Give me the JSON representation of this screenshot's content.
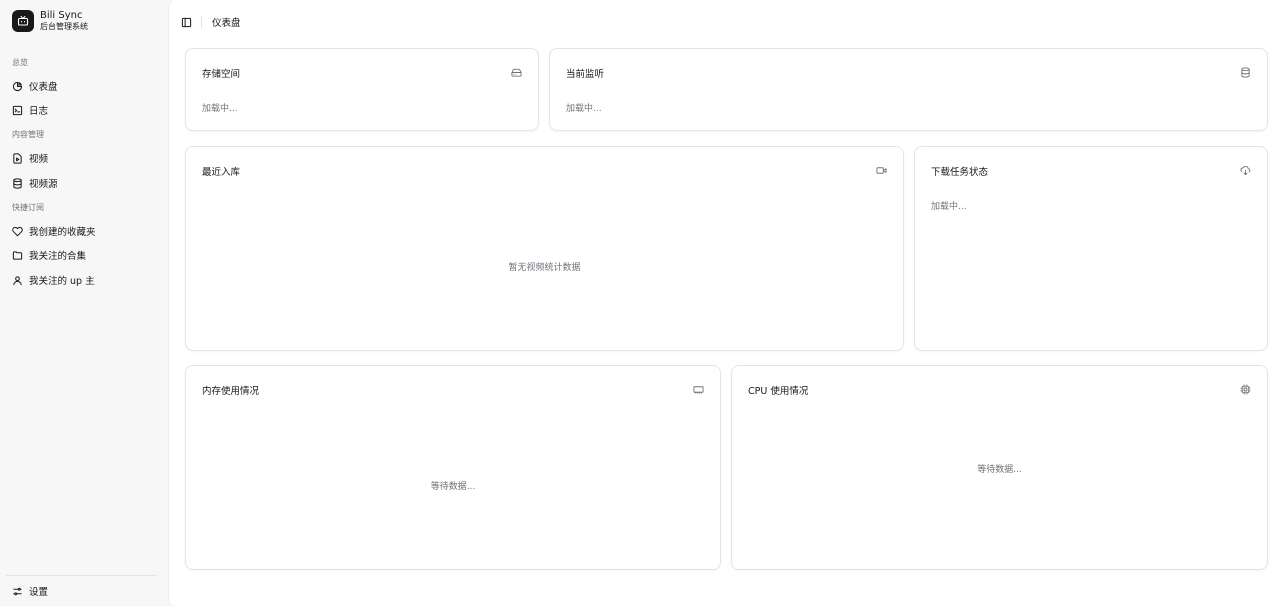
{
  "brand": {
    "name": "Bili Sync",
    "subtitle": "后台管理系统"
  },
  "sidebar": {
    "groups": [
      {
        "label": "总览"
      },
      {
        "label": "内容管理"
      },
      {
        "label": "快捷订阅"
      }
    ],
    "items": [
      {
        "label": "仪表盘",
        "icon": "pie-chart-icon"
      },
      {
        "label": "日志",
        "icon": "terminal-icon"
      },
      {
        "label": "视频",
        "icon": "file-video-icon"
      },
      {
        "label": "视频源",
        "icon": "database-icon"
      },
      {
        "label": "我创建的收藏夹",
        "icon": "heart-icon"
      },
      {
        "label": "我关注的合集",
        "icon": "folder-icon"
      },
      {
        "label": "我关注的 up 主",
        "icon": "user-icon"
      }
    ],
    "footer": {
      "label": "设置",
      "icon": "settings-sliders-icon"
    }
  },
  "topbar": {
    "breadcrumb": "仪表盘"
  },
  "cards": {
    "storage": {
      "title": "存储空间",
      "status": "加载中...",
      "icon": "hard-drive-icon"
    },
    "monitor": {
      "title": "当前监听",
      "status": "加载中...",
      "icon": "database-icon"
    },
    "recent": {
      "title": "最近入库",
      "empty": "暂无视频统计数据",
      "icon": "video-camera-icon"
    },
    "download": {
      "title": "下载任务状态",
      "status": "加载中...",
      "icon": "cloud-download-icon"
    },
    "memory": {
      "title": "内存使用情况",
      "empty": "等待数据...",
      "icon": "memory-stick-icon"
    },
    "cpu": {
      "title": "CPU 使用情况",
      "empty": "等待数据...",
      "icon": "cpu-icon"
    }
  }
}
